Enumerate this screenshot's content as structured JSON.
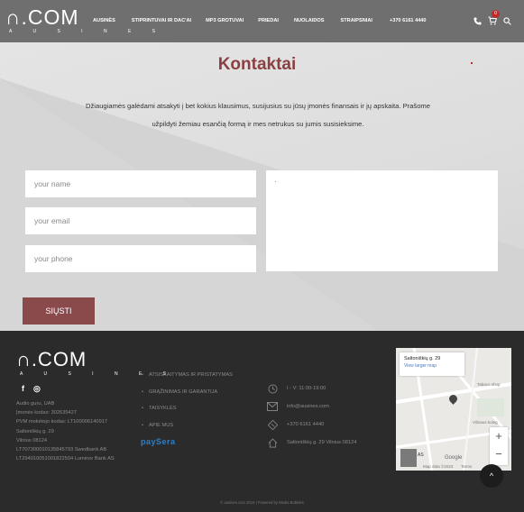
{
  "header": {
    "logo_main": "∩.COM",
    "logo_sub": "A U S I N E S",
    "nav": [
      "AUSINĖS",
      "STIPRINTUVAI IR DAC'AI",
      "MP3 GROTUVAI",
      "PRIEDAI",
      "NUOLAIDOS",
      "STRAIPSNIAI",
      "+370 6161 4440"
    ],
    "cart_count": "0",
    "icons": [
      "phone-icon",
      "cart-icon",
      "search-icon"
    ]
  },
  "main": {
    "title": "Kontaktai",
    "intro": "Džiaugiamės galėdami atsakyti į bet kokius klausimus, susijusius su jūsų įmonės finansais ir jų apskaita. Prašome užpildyti žemiau esančią formą ir mes netrukus su jumis susisieksime.",
    "form": {
      "name_placeholder": "your name",
      "email_placeholder": "your email",
      "phone_placeholder": "your phone",
      "submit_label": "SIŲSTI"
    }
  },
  "footer": {
    "logo_main": "∩.COM",
    "logo_sub": "A U S I N E S",
    "social": [
      "f",
      "◎"
    ],
    "company_lines": [
      "Audio guru, UAB",
      "Įmonės kodas: 302635427",
      "PVM mokėtojo kodas: LT100006140917",
      "Saltoniškių g. 29",
      "Vilnius 08124",
      "LT707300010135845793 Swedbank AB",
      "LT294010051001822504 Luminor Bank AS"
    ],
    "links": [
      "ATSISKAITYMAS IR PRISTATYMAS",
      "GRĄŽINIMAS IR GARANTIJA",
      "TAISYKLĖS",
      "APIE MUS"
    ],
    "paysera": "paySera",
    "contacts": [
      {
        "icon": "clock-icon",
        "text": "I - V: 11:00-19:00"
      },
      {
        "icon": "mail-icon",
        "text": "info@ausines.com"
      },
      {
        "icon": "phone-icon",
        "text": "+370 6161 4440"
      },
      {
        "icon": "home-icon",
        "text": "Saltoniškių g. 29 Vilnius 08124"
      }
    ],
    "map": {
      "title": "Saltoniškių g. 29",
      "link": "View larger map",
      "brand": "Google",
      "street_labels": [
        "Vilniaus koleg",
        "Tabaco shop",
        "Map data ©2023",
        "Terms",
        "AS"
      ]
    },
    "copyright": "© ausines.com 2019 | Powered by Media Bubbles"
  },
  "colors": {
    "header_bg": "#6f6f6f",
    "title": "#8a4042",
    "button": "#8a4a4c",
    "footer_bg": "#2b2b2b",
    "badge": "#c62828",
    "paysera": "#2f7fc6"
  }
}
